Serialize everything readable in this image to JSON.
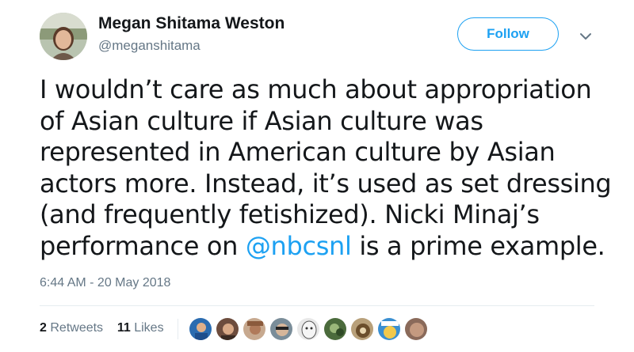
{
  "author": {
    "display_name": "Megan Shitama Weston",
    "handle": "@meganshitama"
  },
  "follow_button": {
    "label": "Follow"
  },
  "tweet": {
    "lines": [
      "I wouldn’t care as much about appropriation",
      "of Asian culture if Asian culture was",
      "represented in American culture by Asian",
      "actors more. Instead, it’s used as set dressing",
      "(and frequently fetishized). Nicki Minaj’s"
    ],
    "last_line_prefix": "performance on ",
    "mention": "@nbcsnl",
    "last_line_suffix": " is a prime example.",
    "timestamp": "6:44 AM - 20 May 2018"
  },
  "stats": {
    "retweets_count": "2",
    "retweets_label": "Retweets",
    "likes_count": "11",
    "likes_label": "Likes"
  },
  "colors": {
    "accent": "#1da1f2",
    "text": "#14171a",
    "muted": "#657786",
    "divider": "#e6ecf0"
  }
}
